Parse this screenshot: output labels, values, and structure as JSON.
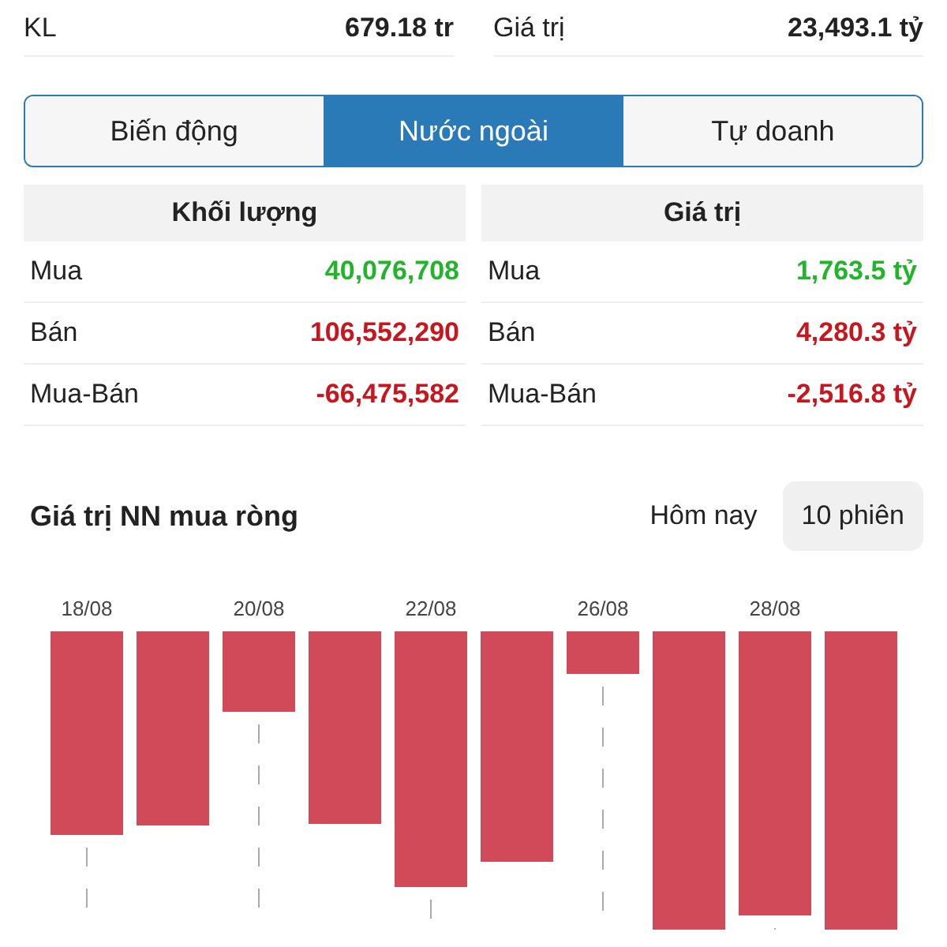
{
  "summary": [
    {
      "label": "KL",
      "value": "679.18 tr"
    },
    {
      "label": "Giá trị",
      "value": "23,493.1 tỷ"
    }
  ],
  "tabs": [
    {
      "label": "Biến động",
      "selected": false
    },
    {
      "label": "Nước ngoài",
      "selected": true
    },
    {
      "label": "Tự doanh",
      "selected": false
    }
  ],
  "tables": [
    {
      "header": "Khối lượng",
      "rows": [
        {
          "label": "Mua",
          "value": "40,076,708",
          "color": "#22b42a"
        },
        {
          "label": "Bán",
          "value": "106,552,290",
          "color": "#c8161e"
        },
        {
          "label": "Mua-Bán",
          "value": "-66,475,582",
          "color": "#c8161e"
        }
      ]
    },
    {
      "header": "Giá trị",
      "rows": [
        {
          "label": "Mua",
          "value": "1,763.5 tỷ",
          "color": "#22b42a"
        },
        {
          "label": "Bán",
          "value": "4,280.3 tỷ",
          "color": "#c8161e"
        },
        {
          "label": "Mua-Bán",
          "value": "-2,516.8 tỷ",
          "color": "#c8161e"
        }
      ]
    }
  ],
  "chart": {
    "title": "Giá trị NN mua ròng",
    "ranges": [
      {
        "label": "Hôm nay",
        "selected": false
      },
      {
        "label": "10 phiên",
        "selected": true
      }
    ],
    "date_labels": [
      "18/08",
      "20/08",
      "22/08",
      "26/08",
      "28/08"
    ]
  }
}
